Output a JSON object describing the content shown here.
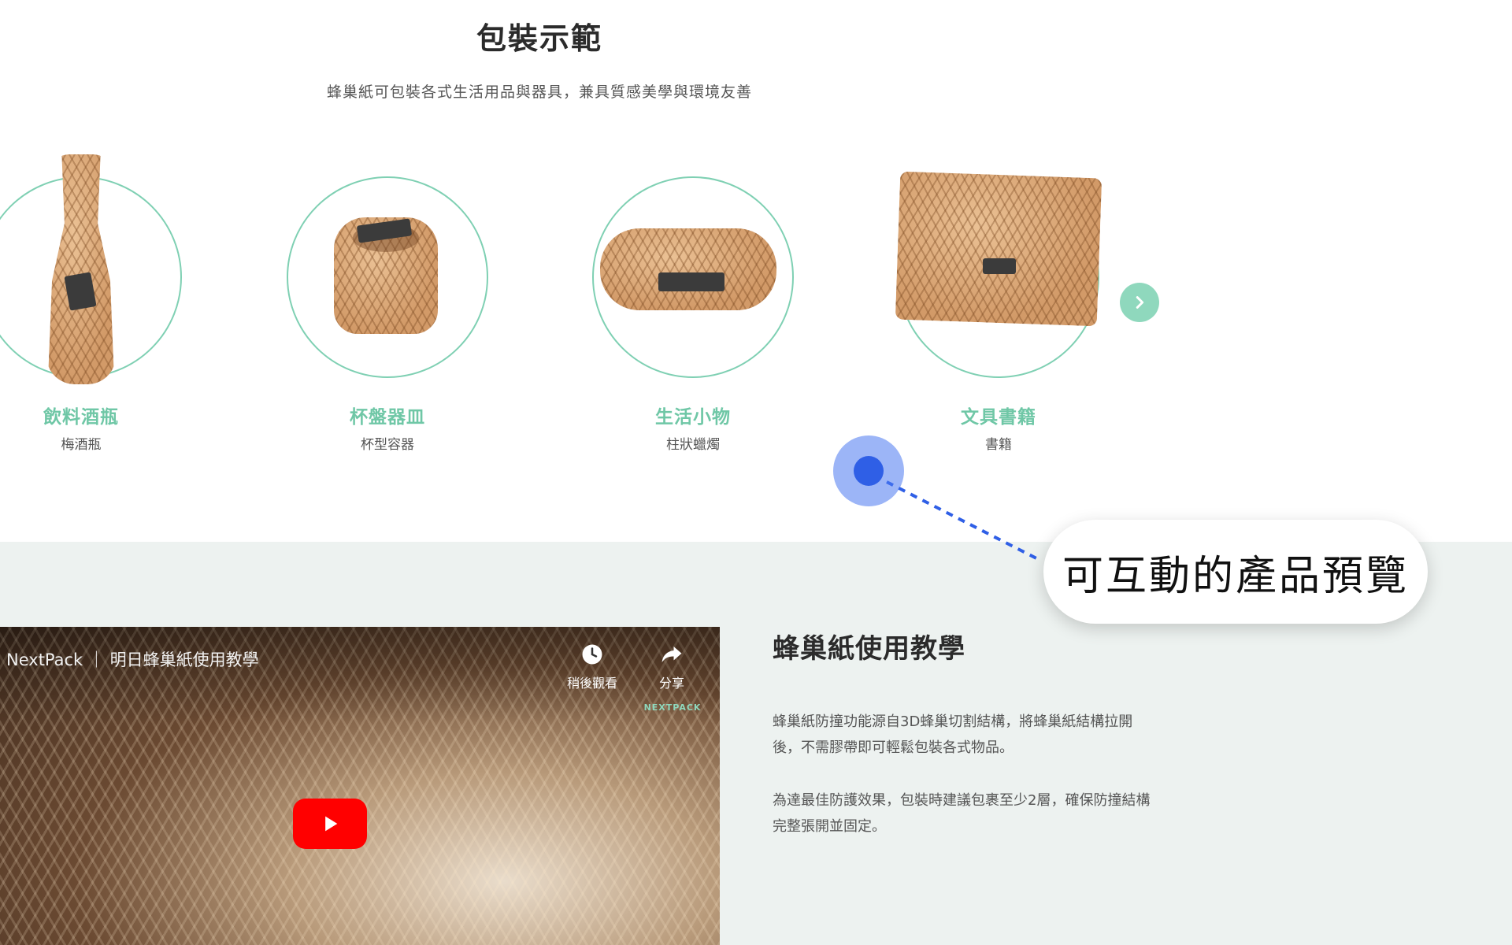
{
  "showcase": {
    "title": "包裝示範",
    "subtitle": "蜂巢紙可包裝各式生活用品與器具，兼具質感美學與環境友善",
    "items": [
      {
        "name": "飲料酒瓶",
        "desc": "梅酒瓶"
      },
      {
        "name": "杯盤器皿",
        "desc": "杯型容器"
      },
      {
        "name": "生活小物",
        "desc": "柱狀蠟燭"
      },
      {
        "name": "文具書籍",
        "desc": "書籍"
      }
    ],
    "next_icon": "chevron-right-icon"
  },
  "tutorial": {
    "heading": "蜂巢紙使用教學",
    "paragraph_1": "蜂巢紙防撞功能源自3D蜂巢切割結構，將蜂巢紙結構拉開後，不需膠帶即可輕鬆包裝各式物品。",
    "paragraph_2": "為達最佳防護效果，包裝時建議包裹至少2層，確保防撞結構完整張開並固定。",
    "video": {
      "title": "NextPack ｜ 明日蜂巢紙使用教學",
      "watch_later_label": "稍後觀看",
      "share_label": "分享",
      "logo_text": "NEXTPACK"
    }
  },
  "annotation": {
    "callout_text": "可互動的產品預覽"
  },
  "colors": {
    "accent": "#6fc7a6",
    "ring": "#7fd0b3",
    "tutorial_bg": "#edf2f0",
    "hotspot": "#2f5fe6",
    "play": "#ff0000"
  }
}
